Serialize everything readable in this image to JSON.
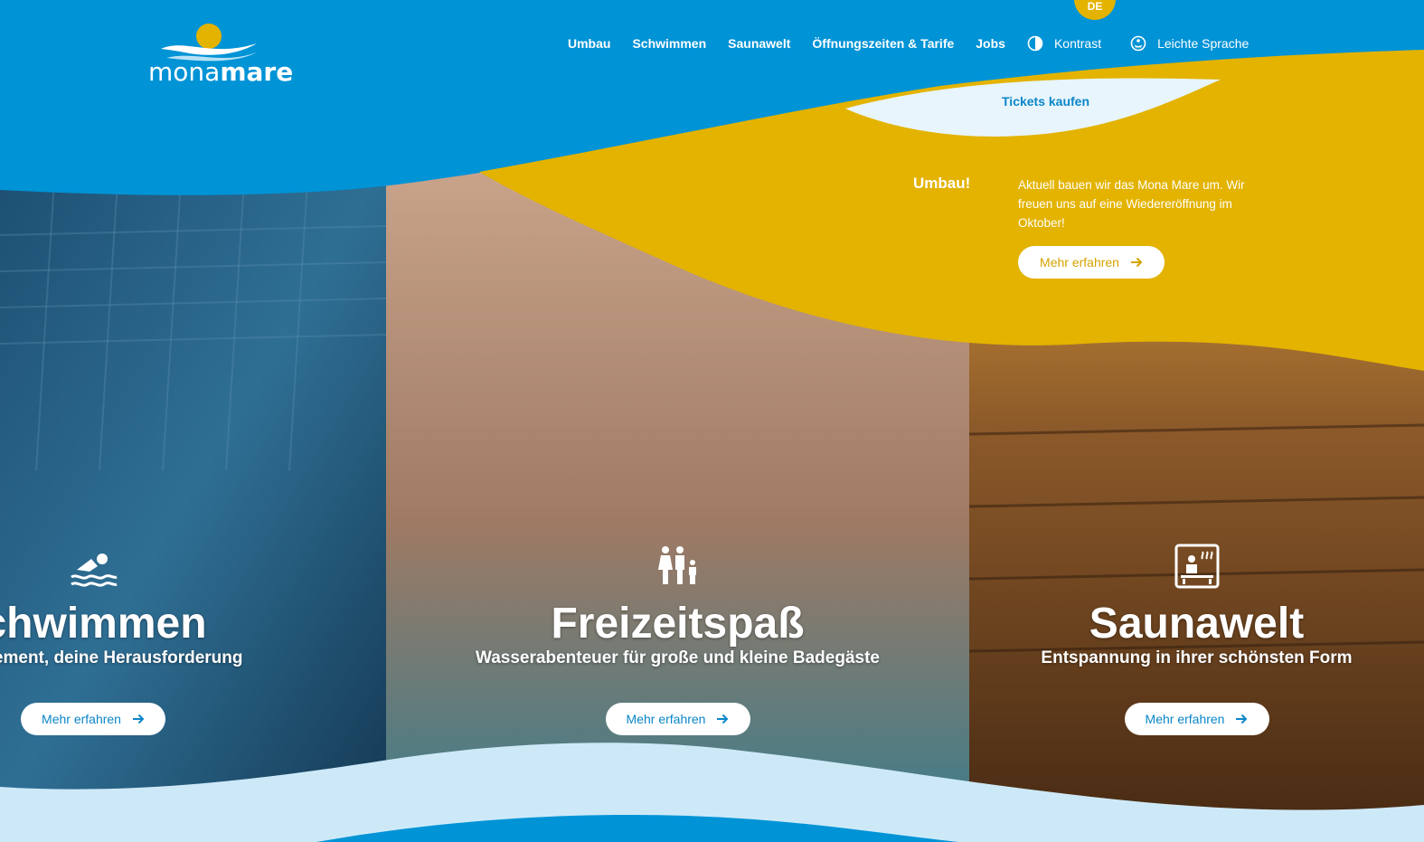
{
  "brand": {
    "logo_light": "mona",
    "logo_bold": "mare"
  },
  "language": {
    "current": "DE"
  },
  "nav": {
    "items": [
      "Umbau",
      "Schwimmen",
      "Saunawelt",
      "Öffnungszeiten & Tarife",
      "Jobs"
    ],
    "contrast_label": "Kontrast",
    "easy_language_label": "Leichte Sprache",
    "tickets_label": "Tickets kaufen"
  },
  "notice": {
    "title": "Umbau!",
    "text": "Aktuell bauen wir das Mona Mare um. Wir freuen uns auf eine Wiedereröffnung im Oktober!",
    "button_label": "Mehr erfahren"
  },
  "panels": [
    {
      "title": "Schwimmen",
      "subtitle": "Dein Element, deine Herausforderung",
      "button_label": "Mehr erfahren",
      "icon": "swimmer-icon"
    },
    {
      "title": "Freizeitspaß",
      "subtitle": "Wasserabenteuer für große und kleine Badegäste",
      "button_label": "Mehr erfahren",
      "icon": "family-icon"
    },
    {
      "title": "Saunawelt",
      "subtitle": "Entspannung in ihrer schönsten Form",
      "button_label": "Mehr erfahren",
      "icon": "sauna-icon"
    }
  ],
  "colors": {
    "brand_blue": "#0093d6",
    "accent_yellow": "#e3b300",
    "light_blue": "#cde9f8",
    "button_text_blue": "#0a86c8"
  }
}
